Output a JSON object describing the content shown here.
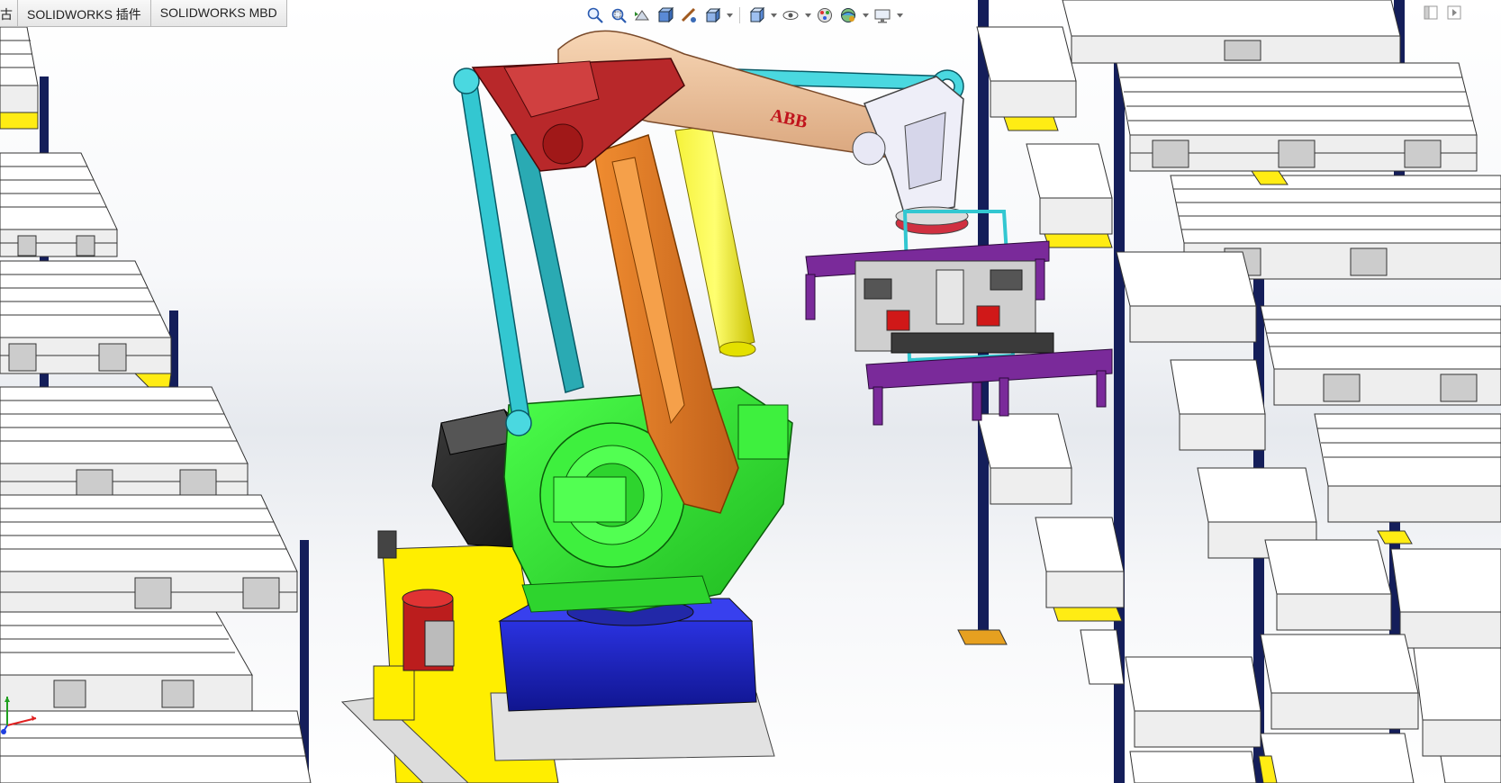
{
  "command_tabs": [
    {
      "label": "古"
    },
    {
      "label": "SOLIDWORKS 插件"
    },
    {
      "label": "SOLIDWORKS MBD"
    }
  ],
  "heads_up_toolbar": {
    "buttons": [
      {
        "icon": "zoom-to-fit-icon"
      },
      {
        "icon": "zoom-to-area-icon"
      },
      {
        "icon": "previous-view-icon"
      },
      {
        "icon": "section-view-icon"
      },
      {
        "icon": "dynamic-annotation-views-icon"
      },
      {
        "icon": "view-orientation-icon"
      },
      {
        "icon": "display-style-icon"
      },
      {
        "icon": "hide-show-items-icon"
      },
      {
        "icon": "edit-appearance-icon"
      },
      {
        "icon": "apply-scene-icon"
      },
      {
        "icon": "view-settings-icon"
      }
    ]
  },
  "window_controls": [
    {
      "icon": "tile-left-icon"
    },
    {
      "icon": "tile-right-icon"
    }
  ],
  "model": {
    "robot_brand_label": "ABB"
  },
  "colors": {
    "robot_base_blue": "#1a1fbf",
    "robot_body_green": "#2ee62e",
    "arm_orange": "#e07b20",
    "arm_peach": "#f2c59e",
    "top_link_red": "#b8282a",
    "link_cyan": "#33c7d1",
    "gripper_purple": "#7a2a9a",
    "platform_yellow": "#ffee00",
    "pallet_white": "#ffffff",
    "rack_navy": "#141e5a",
    "rack_yellow_beam": "#ffec14"
  }
}
